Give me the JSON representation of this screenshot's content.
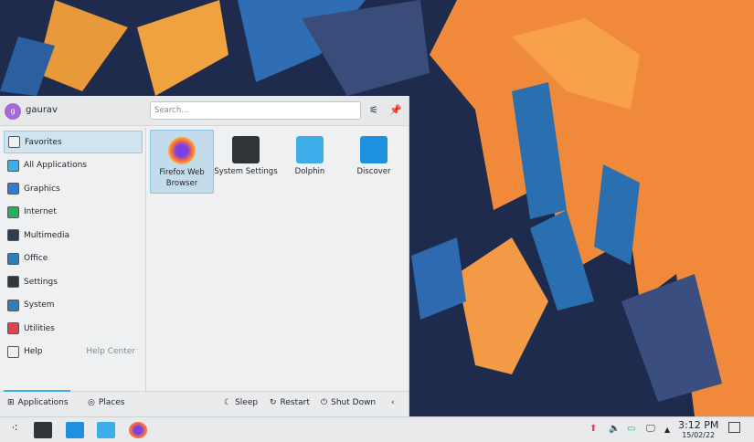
{
  "user": {
    "initial": "g",
    "name": "gaurav"
  },
  "search": {
    "placeholder": "Search..."
  },
  "sidebar": {
    "items": [
      {
        "label": "Favorites",
        "icon": "bookmark-icon",
        "color": "#eff0f1"
      },
      {
        "label": "All Applications",
        "icon": "grid-icon",
        "color": "#3daee9"
      },
      {
        "label": "Graphics",
        "icon": "graphics-icon",
        "color": "#2a7fd4"
      },
      {
        "label": "Internet",
        "icon": "globe-icon",
        "color": "#27ae60"
      },
      {
        "label": "Multimedia",
        "icon": "multimedia-icon",
        "color": "#2c3e50"
      },
      {
        "label": "Office",
        "icon": "office-icon",
        "color": "#2980b9"
      },
      {
        "label": "Settings",
        "icon": "settings-icon",
        "color": "#31363b"
      },
      {
        "label": "System",
        "icon": "system-icon",
        "color": "#2c7fb8"
      },
      {
        "label": "Utilities",
        "icon": "toolbox-icon",
        "color": "#da4453"
      },
      {
        "label": "Help",
        "icon": "help-icon",
        "color": "#eff0f1",
        "extra": "Help Center"
      }
    ]
  },
  "favorites": [
    {
      "label": "Firefox Web Browser",
      "icon": "firefox-icon",
      "color": "#ff7139"
    },
    {
      "label": "System Settings",
      "icon": "system-settings-icon",
      "color": "#2f3438"
    },
    {
      "label": "Dolphin",
      "icon": "folder-icon",
      "color": "#3daee9"
    },
    {
      "label": "Discover",
      "icon": "discover-icon",
      "color": "#1e90e0"
    }
  ],
  "footer": {
    "applications": "Applications",
    "places": "Places",
    "sleep": "Sleep",
    "restart": "Restart",
    "shutdown": "Shut Down"
  },
  "clock": {
    "time": "3:12 PM",
    "date": "15/02/22"
  }
}
